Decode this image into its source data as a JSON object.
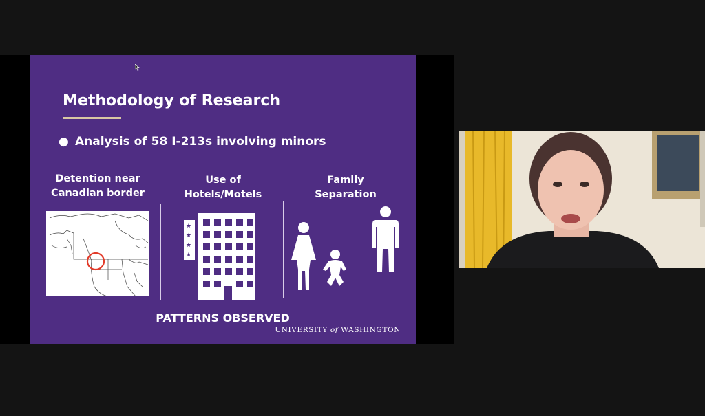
{
  "slide": {
    "title": "Methodology of Research",
    "bullet": "Analysis of 58 I-213s involving minors",
    "columns": [
      {
        "heading_line1": "Detention near",
        "heading_line2": "Canadian border",
        "icon": "north-america-map-icon"
      },
      {
        "heading_line1": "Use of",
        "heading_line2": "Hotels/Motels",
        "icon": "hotel-building-icon"
      },
      {
        "heading_line1": "Family",
        "heading_line2": "Separation",
        "icon": "family-separation-icon"
      }
    ],
    "footer": "PATTERNS OBSERVED",
    "logo": {
      "part1": "UNIVERSITY",
      "part2": "of",
      "part3": "WASHINGTON"
    }
  },
  "colors": {
    "slide_background": "#4f2d83",
    "title_underline": "#d9c7a3",
    "map_marker": "#e23b2a",
    "video_wall": "#e9e2d4",
    "curtain": "#e8b92a"
  },
  "video": {
    "participant_icon": "presenter-video-feed"
  }
}
